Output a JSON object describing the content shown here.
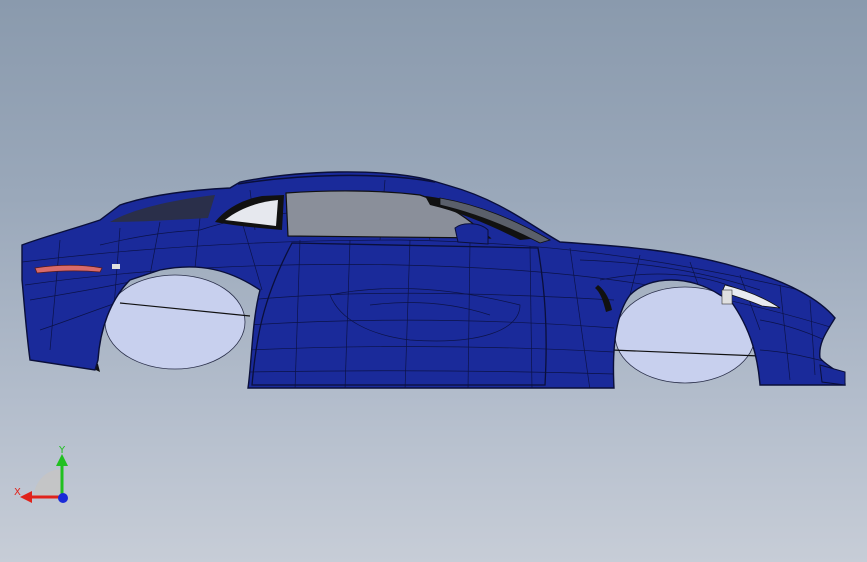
{
  "viewport": {
    "model": "car-body-mesh",
    "colors": {
      "background_top": "#8a9aad",
      "background_bottom": "#c7cdd7",
      "body": "#1a2a9a",
      "mesh_lines": "#0a0f3a",
      "wheel_arch": "#c8d0ee",
      "glass": "#8a8f9a",
      "taillight": "#d86a6a"
    }
  },
  "triad": {
    "x_label": "X",
    "y_label": "Y",
    "colors": {
      "x": "#e0231b",
      "y": "#20c020",
      "z": "#1a2bd8",
      "plane": "#c4c4c4"
    }
  }
}
